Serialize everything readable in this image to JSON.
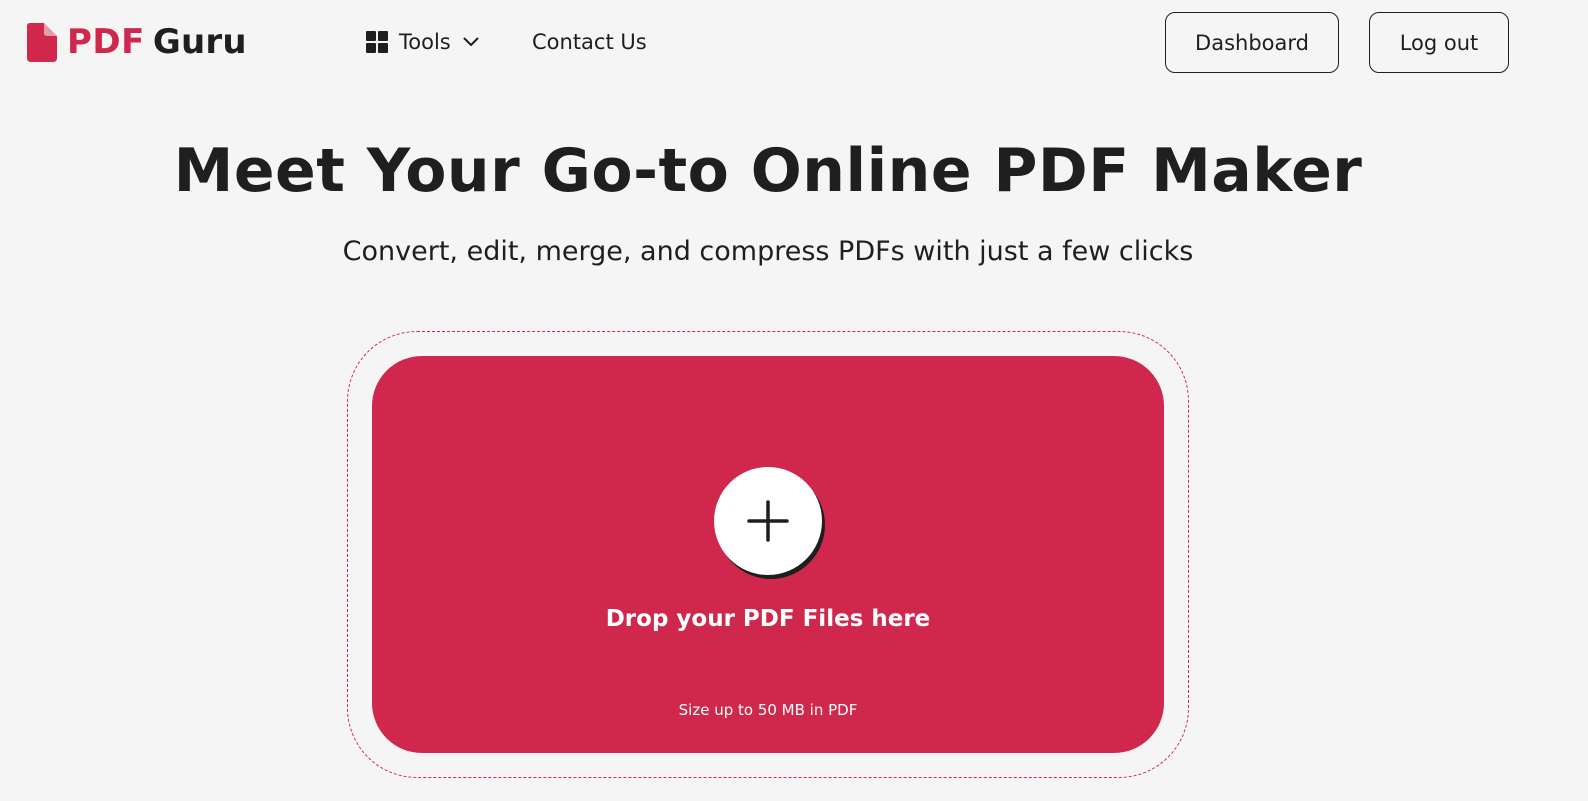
{
  "brand": {
    "logo_part1": "PDF",
    "logo_part2": "Guru",
    "accent_color": "#d0284c",
    "logo_icon": "document-icon"
  },
  "nav": {
    "tools_label": "Tools",
    "tools_icon": "grid-icon",
    "tools_chevron": "chevron-down-icon",
    "contact_label": "Contact Us"
  },
  "header_buttons": {
    "dashboard_label": "Dashboard",
    "logout_label": "Log out"
  },
  "hero": {
    "title": "Meet Your Go-to Online PDF Maker",
    "subtitle": "Convert, edit, merge, and compress PDFs with just a few clicks"
  },
  "dropzone": {
    "icon": "plus-icon",
    "label": "Drop your PDF Files here",
    "size_note": "Size up to 50 MB in PDF",
    "background_color": "#d0284c"
  }
}
